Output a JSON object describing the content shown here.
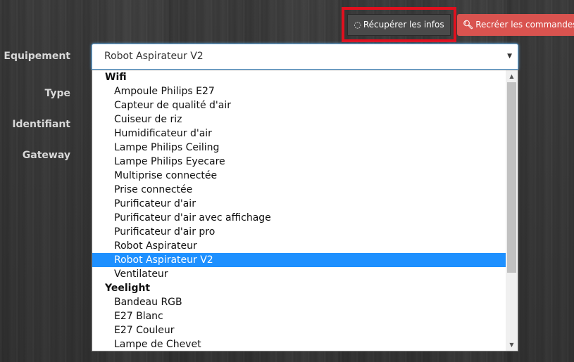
{
  "toolbar": {
    "fetch_info_label": "Récupérer les infos",
    "recreate_commands_label": "Recréer les commandes"
  },
  "form": {
    "equipement_label": "Equipement",
    "type_label": "Type",
    "identifiant_label": "Identifiant",
    "gateway_label": "Gateway",
    "selected_value": "Robot Aspirateur V2"
  },
  "dropdown": {
    "groups": [
      {
        "label": "Wifi",
        "options": [
          "Ampoule Philips E27",
          "Capteur de qualité d'air",
          "Cuiseur de riz",
          "Humidificateur d'air",
          "Lampe Philips Ceiling",
          "Lampe Philips Eyecare",
          "Multiprise connectée",
          "Prise connectée",
          "Purificateur d'air",
          "Purificateur d'air avec affichage",
          "Purificateur d'air pro",
          "Robot Aspirateur",
          "Robot Aspirateur V2",
          "Ventilateur"
        ]
      },
      {
        "label": "Yeelight",
        "options": [
          "Bandeau RGB",
          "E27 Blanc",
          "E27 Couleur",
          "Lampe de Chevet"
        ]
      }
    ]
  },
  "colors": {
    "highlight": "#e0101e",
    "danger_button": "#d9534f",
    "selected_option": "#1e90ff"
  },
  "icons": {
    "fetch": "spinner-icon",
    "recreate": "search-icon",
    "caret": "caret-down-icon"
  }
}
